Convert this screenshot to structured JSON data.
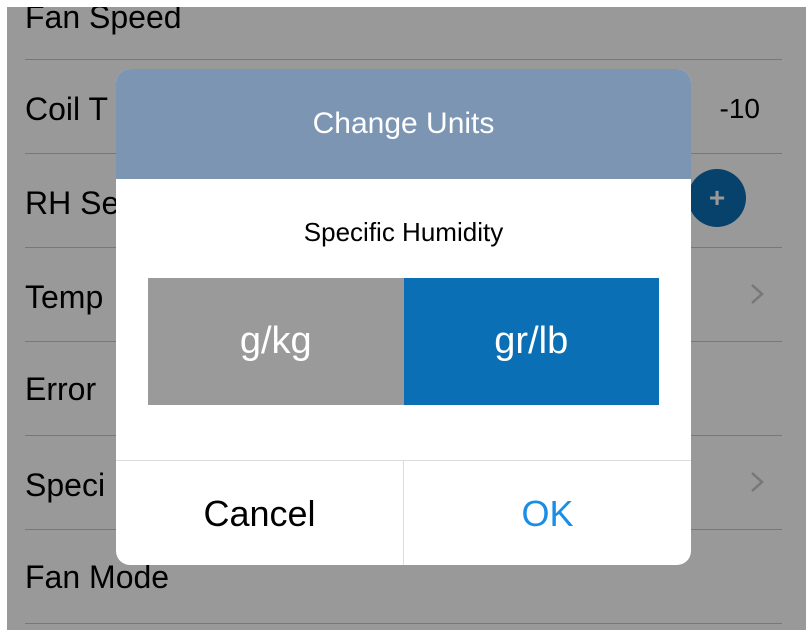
{
  "settings": {
    "rows": [
      {
        "label": "Fan Speed"
      },
      {
        "label": "Coil T",
        "value": "-10"
      },
      {
        "label": "RH Se"
      },
      {
        "label": "Temp"
      },
      {
        "label": "Error"
      },
      {
        "label": "Speci"
      },
      {
        "label": "Fan Mode"
      }
    ],
    "plus_label": "+",
    "chevron_icon": "chevron-right-icon"
  },
  "dialog": {
    "title": "Change Units",
    "subtitle": "Specific Humidity",
    "options": [
      {
        "label": "g/kg",
        "selected": false
      },
      {
        "label": "gr/lb",
        "selected": true
      }
    ],
    "cancel_label": "Cancel",
    "ok_label": "OK"
  },
  "colors": {
    "header_bg": "#7b95b3",
    "selected_bg": "#0a6fb4",
    "unselected_bg": "#9a9a9a",
    "ok_text": "#1a8ee6",
    "overlay": "rgba(0,0,0,0.40)"
  }
}
